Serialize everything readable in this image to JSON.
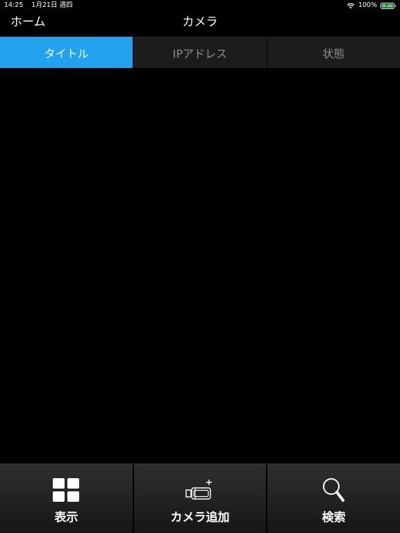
{
  "status_bar": {
    "time": "14:25",
    "date": "1月21日 週四",
    "battery": "100%"
  },
  "nav": {
    "back_label": "ホーム",
    "title": "カメラ"
  },
  "tabs": [
    {
      "label": "タイトル",
      "active": true
    },
    {
      "label": "IPアドレス",
      "active": false
    },
    {
      "label": "状態",
      "active": false
    }
  ],
  "toolbar": {
    "display_label": "表示",
    "add_camera_label": "カメラ追加",
    "search_label": "検索"
  },
  "colors": {
    "accent": "#21a3f0",
    "background": "#000000",
    "battery": "#4cd964"
  },
  "icons": {
    "display": "grid-icon",
    "add_camera": "camera-add-icon",
    "search": "magnifier-icon"
  }
}
